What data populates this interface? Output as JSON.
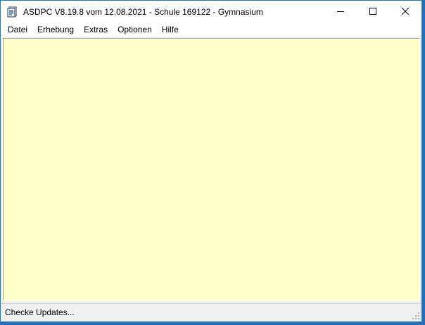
{
  "window": {
    "title": "ASDPC V8.19.8 vom 12.08.2021 - Schule 169122 - Gymnasium",
    "icon": "app-document-icon",
    "controls": {
      "minimize": "minimize-icon",
      "maximize": "maximize-icon",
      "close": "close-icon"
    }
  },
  "menu": {
    "items": [
      {
        "label": "Datei"
      },
      {
        "label": "Erhebung"
      },
      {
        "label": "Extras"
      },
      {
        "label": "Optionen"
      },
      {
        "label": "Hilfe"
      }
    ]
  },
  "client": {
    "background": "#ffffc8"
  },
  "status": {
    "text": "Checke Updates..."
  }
}
